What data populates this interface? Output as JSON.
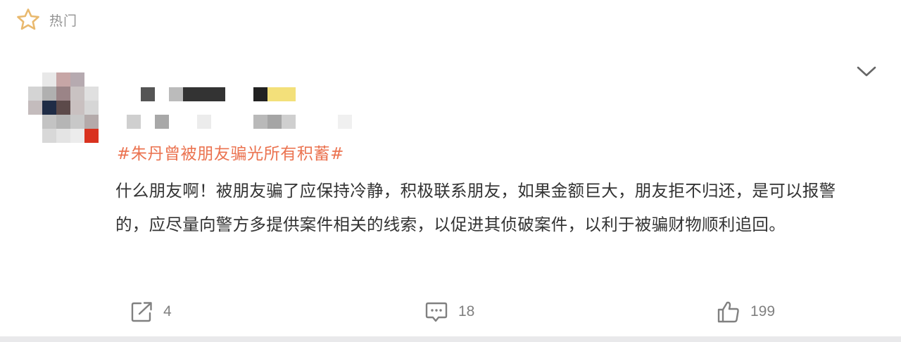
{
  "header": {
    "title": "热门",
    "icon": "star-outline-icon"
  },
  "user": {
    "avatar_note": "pixelated",
    "name_note": "pixelated",
    "meta_note": "pixelated"
  },
  "post": {
    "topic": "#朱丹曾被朋友骗光所有积蓄#",
    "text": "什么朋友啊！被朋友骗了应保持冷静，积极联系朋友，如果金额巨大，朋友拒不归还，是可以报警的，应尽量向警方多提供案件相关的线索，以促进其侦破案件，以利于被骗财物顺利追回。"
  },
  "actions": {
    "repost": {
      "icon": "share-icon",
      "count": "4"
    },
    "comment": {
      "icon": "comment-icon",
      "count": "18"
    },
    "like": {
      "icon": "thumbs-up-icon",
      "count": "199"
    }
  },
  "colors": {
    "topic": "#eb7350",
    "text": "#333333",
    "muted": "#808080",
    "page_bg": "#e9e9eb",
    "card_bg": "#ffffff"
  }
}
